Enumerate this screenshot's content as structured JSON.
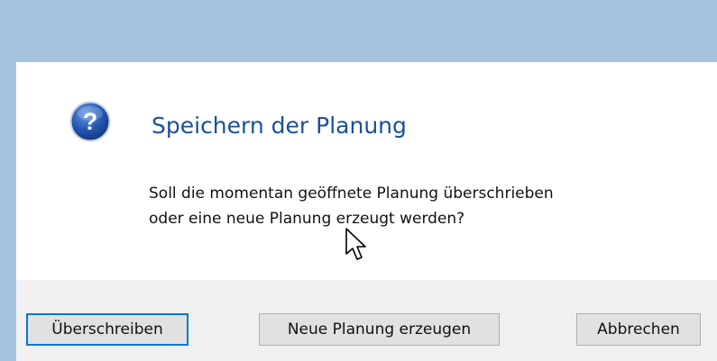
{
  "dialog": {
    "icon": "question-icon",
    "title": "Speichern der Planung",
    "message_lines": [
      "Soll die momentan geöffnete Planung überschrieben",
      "oder eine neue Planung erzeugt werden?"
    ],
    "buttons": {
      "overwrite": "Überschreiben",
      "create_new": "Neue Planung erzeugen",
      "cancel": "Abbrechen"
    }
  },
  "colors": {
    "window_frame": "#a5c3de",
    "title_text": "#1b4f9c",
    "footer_bg": "#f0f0f0",
    "button_bg": "#e1e1e1",
    "default_button_border": "#0078d7"
  }
}
